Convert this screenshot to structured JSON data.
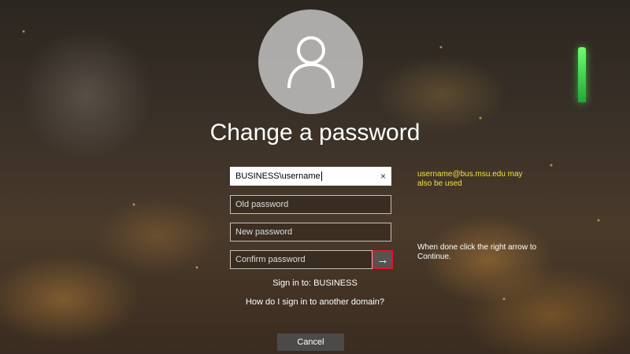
{
  "title": "Change a password",
  "fields": {
    "username": {
      "value": "BUSINESS\\username",
      "clear_icon": "×"
    },
    "old_password": {
      "placeholder": "Old password"
    },
    "new_password": {
      "placeholder": "New password"
    },
    "confirm_password": {
      "placeholder": "Confirm password"
    }
  },
  "submit_icon": "→",
  "notes": {
    "email_hint": "username@bus.msu.edu may also be used",
    "arrow_hint": "When done click the right arrow to Continue."
  },
  "signin": {
    "domain_text": "Sign in to: BUSINESS",
    "other_domain_link": "How do I sign in to another domain?"
  },
  "cancel_label": "Cancel",
  "colors": {
    "highlight_border": "#e0162b",
    "note_yellow": "#f2e23c",
    "minaret_green": "#33e04a"
  }
}
